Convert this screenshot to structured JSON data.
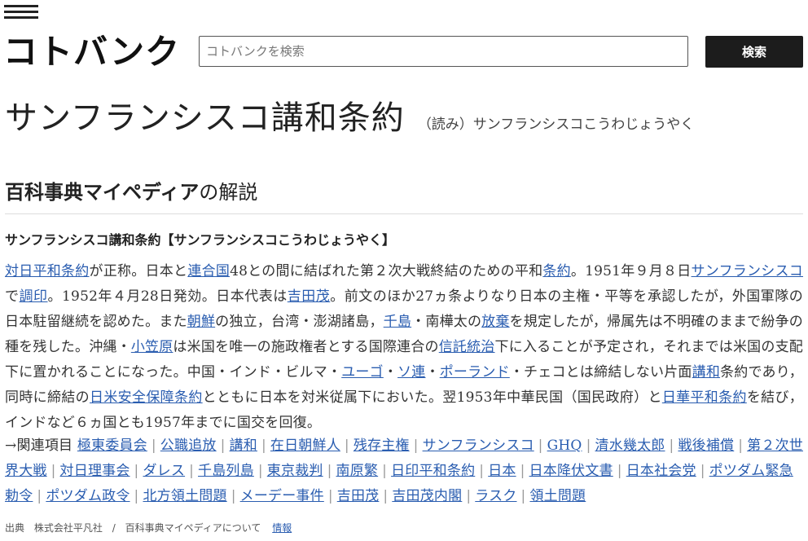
{
  "header": {
    "logo": "コトバンク",
    "search_placeholder": "コトバンクを検索",
    "search_button": "検索"
  },
  "title": {
    "main": "サンフランシスコ講和条約",
    "reading": "（読み）サンフランシスコこうわじょうやく"
  },
  "source": {
    "name_bold": "百科事典マイペディア",
    "suffix": "の解説"
  },
  "entry_heading": "サンフランシスコ講和条約【サンフランシスコこうわじょうやく】",
  "body_segments": [
    {
      "link": true,
      "text": "対日平和条約"
    },
    {
      "link": false,
      "text": "が正称。日本と"
    },
    {
      "link": true,
      "text": "連合国"
    },
    {
      "link": false,
      "text": "48との間に結ばれた第２次大戦終結のための平和"
    },
    {
      "link": true,
      "text": "条約"
    },
    {
      "link": false,
      "text": "。1951年９月８日"
    },
    {
      "link": true,
      "text": "サンフランシスコ"
    },
    {
      "link": false,
      "text": "で"
    },
    {
      "link": true,
      "text": "調印"
    },
    {
      "link": false,
      "text": "。1952年４月28日発効。日本代表は"
    },
    {
      "link": true,
      "text": "吉田茂"
    },
    {
      "link": false,
      "text": "。前文のほか27ヵ条よりなり日本の主権・平等を承認したが，外国軍隊の日本駐留継続を認めた。また"
    },
    {
      "link": true,
      "text": "朝鮮"
    },
    {
      "link": false,
      "text": "の独立，台湾・澎湖諸島，"
    },
    {
      "link": true,
      "text": "千島"
    },
    {
      "link": false,
      "text": "・南樺太の"
    },
    {
      "link": true,
      "text": "放棄"
    },
    {
      "link": false,
      "text": "を規定したが，帰属先は不明確のままで紛争の種を残した。沖縄・"
    },
    {
      "link": true,
      "text": "小笠原"
    },
    {
      "link": false,
      "text": "は米国を唯一の施政権者とする国際連合の"
    },
    {
      "link": true,
      "text": "信託統治"
    },
    {
      "link": false,
      "text": "下に入ることが予定され，それまでは米国の支配下に置かれることになった。中国・インド・ビルマ・"
    },
    {
      "link": true,
      "text": "ユーゴ"
    },
    {
      "link": false,
      "text": "・"
    },
    {
      "link": true,
      "text": "ソ連"
    },
    {
      "link": false,
      "text": "・"
    },
    {
      "link": true,
      "text": "ポーランド"
    },
    {
      "link": false,
      "text": "・チェコとは締結しない片面"
    },
    {
      "link": true,
      "text": "講和"
    },
    {
      "link": false,
      "text": "条約であり，同時に締結の"
    },
    {
      "link": true,
      "text": "日米安全保障条約"
    },
    {
      "link": false,
      "text": "とともに日本を対米従属下においた。翌1953年中華民国（国民政府）と"
    },
    {
      "link": true,
      "text": "日華平和条約"
    },
    {
      "link": false,
      "text": "を結び，インドなど６ヵ国とも1957年までに国交を回復。"
    }
  ],
  "related": {
    "prefix": "→関連項目",
    "items": [
      "極東委員会",
      "公職追放",
      "講和",
      "在日朝鮮人",
      "残存主権",
      "サンフランシスコ",
      "GHQ",
      "清水幾太郎",
      "戦後補償",
      "第２次世界大戦",
      "対日理事会",
      "ダレス",
      "千島列島",
      "東京裁判",
      "南原繁",
      "日印平和条約",
      "日本",
      "日本降伏文書",
      "日本社会党",
      "ポツダム緊急勅令",
      "ポツダム政令",
      "北方領土問題",
      "メーデー事件",
      "吉田茂",
      "吉田茂内閣",
      "ラスク",
      "領土問題"
    ]
  },
  "footer": {
    "source_label": "出典",
    "publisher": "株式会社平凡社",
    "slash": "/",
    "about": "百科事典マイペディアについて",
    "info_link": "情報"
  }
}
